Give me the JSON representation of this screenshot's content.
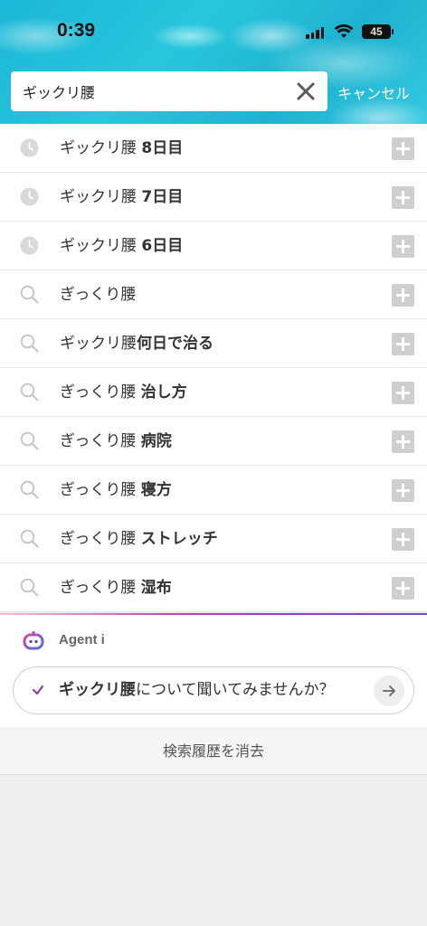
{
  "status_bar": {
    "time": "0:39",
    "battery": "45"
  },
  "search": {
    "value": "ギックリ腰",
    "cancel_label": "キャンセル"
  },
  "suggestions": [
    {
      "type": "history",
      "prefix": "ギックリ腰 ",
      "highlight": "8日目"
    },
    {
      "type": "history",
      "prefix": "ギックリ腰 ",
      "highlight": "7日目"
    },
    {
      "type": "history",
      "prefix": "ギックリ腰 ",
      "highlight": "6日目"
    },
    {
      "type": "search",
      "prefix": "ぎっくり腰",
      "highlight": ""
    },
    {
      "type": "search",
      "prefix": "ギックリ腰",
      "highlight": "何日で治る"
    },
    {
      "type": "search",
      "prefix": "ぎっくり腰 ",
      "highlight": "治し方"
    },
    {
      "type": "search",
      "prefix": "ぎっくり腰 ",
      "highlight": "病院"
    },
    {
      "type": "search",
      "prefix": "ぎっくり腰 ",
      "highlight": "寝方"
    },
    {
      "type": "search",
      "prefix": "ぎっくり腰 ",
      "highlight": "ストレッチ"
    },
    {
      "type": "search",
      "prefix": "ぎっくり腰 ",
      "highlight": "湿布"
    }
  ],
  "agent": {
    "title": "Agent i",
    "prompt_keyword": "ギックリ腰",
    "prompt_rest": "について聞いてみませんか？"
  },
  "clear_history_label": "検索履歴を消去",
  "colors": {
    "header": "#29c6de",
    "agent_gradient_start": "#b24fa8",
    "agent_gradient_end": "#6d4cc8"
  }
}
